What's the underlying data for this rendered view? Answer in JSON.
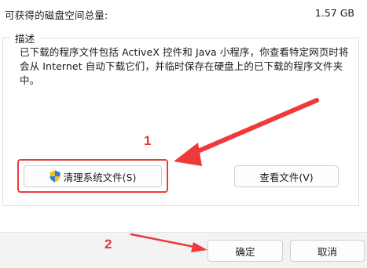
{
  "header": {
    "space_label": "可获得的磁盘空间总量:",
    "space_value": "1.57 GB"
  },
  "description": {
    "title": "描述",
    "text": "已下载的程序文件包括 ActiveX 控件和 Java 小程序，你查看特定网页时将会从 Internet 自动下载它们，并临时保存在硬盘上的已下载的程序文件夹中。"
  },
  "buttons": {
    "cleanup_label": "清理系统文件(S)",
    "view_files_label": "查看文件(V)",
    "ok_label": "确定",
    "cancel_label": "取消"
  },
  "annotations": {
    "step1": "1",
    "step2": "2",
    "color": "#e8363a"
  },
  "icons": {
    "shield": "uac-shield-icon"
  }
}
